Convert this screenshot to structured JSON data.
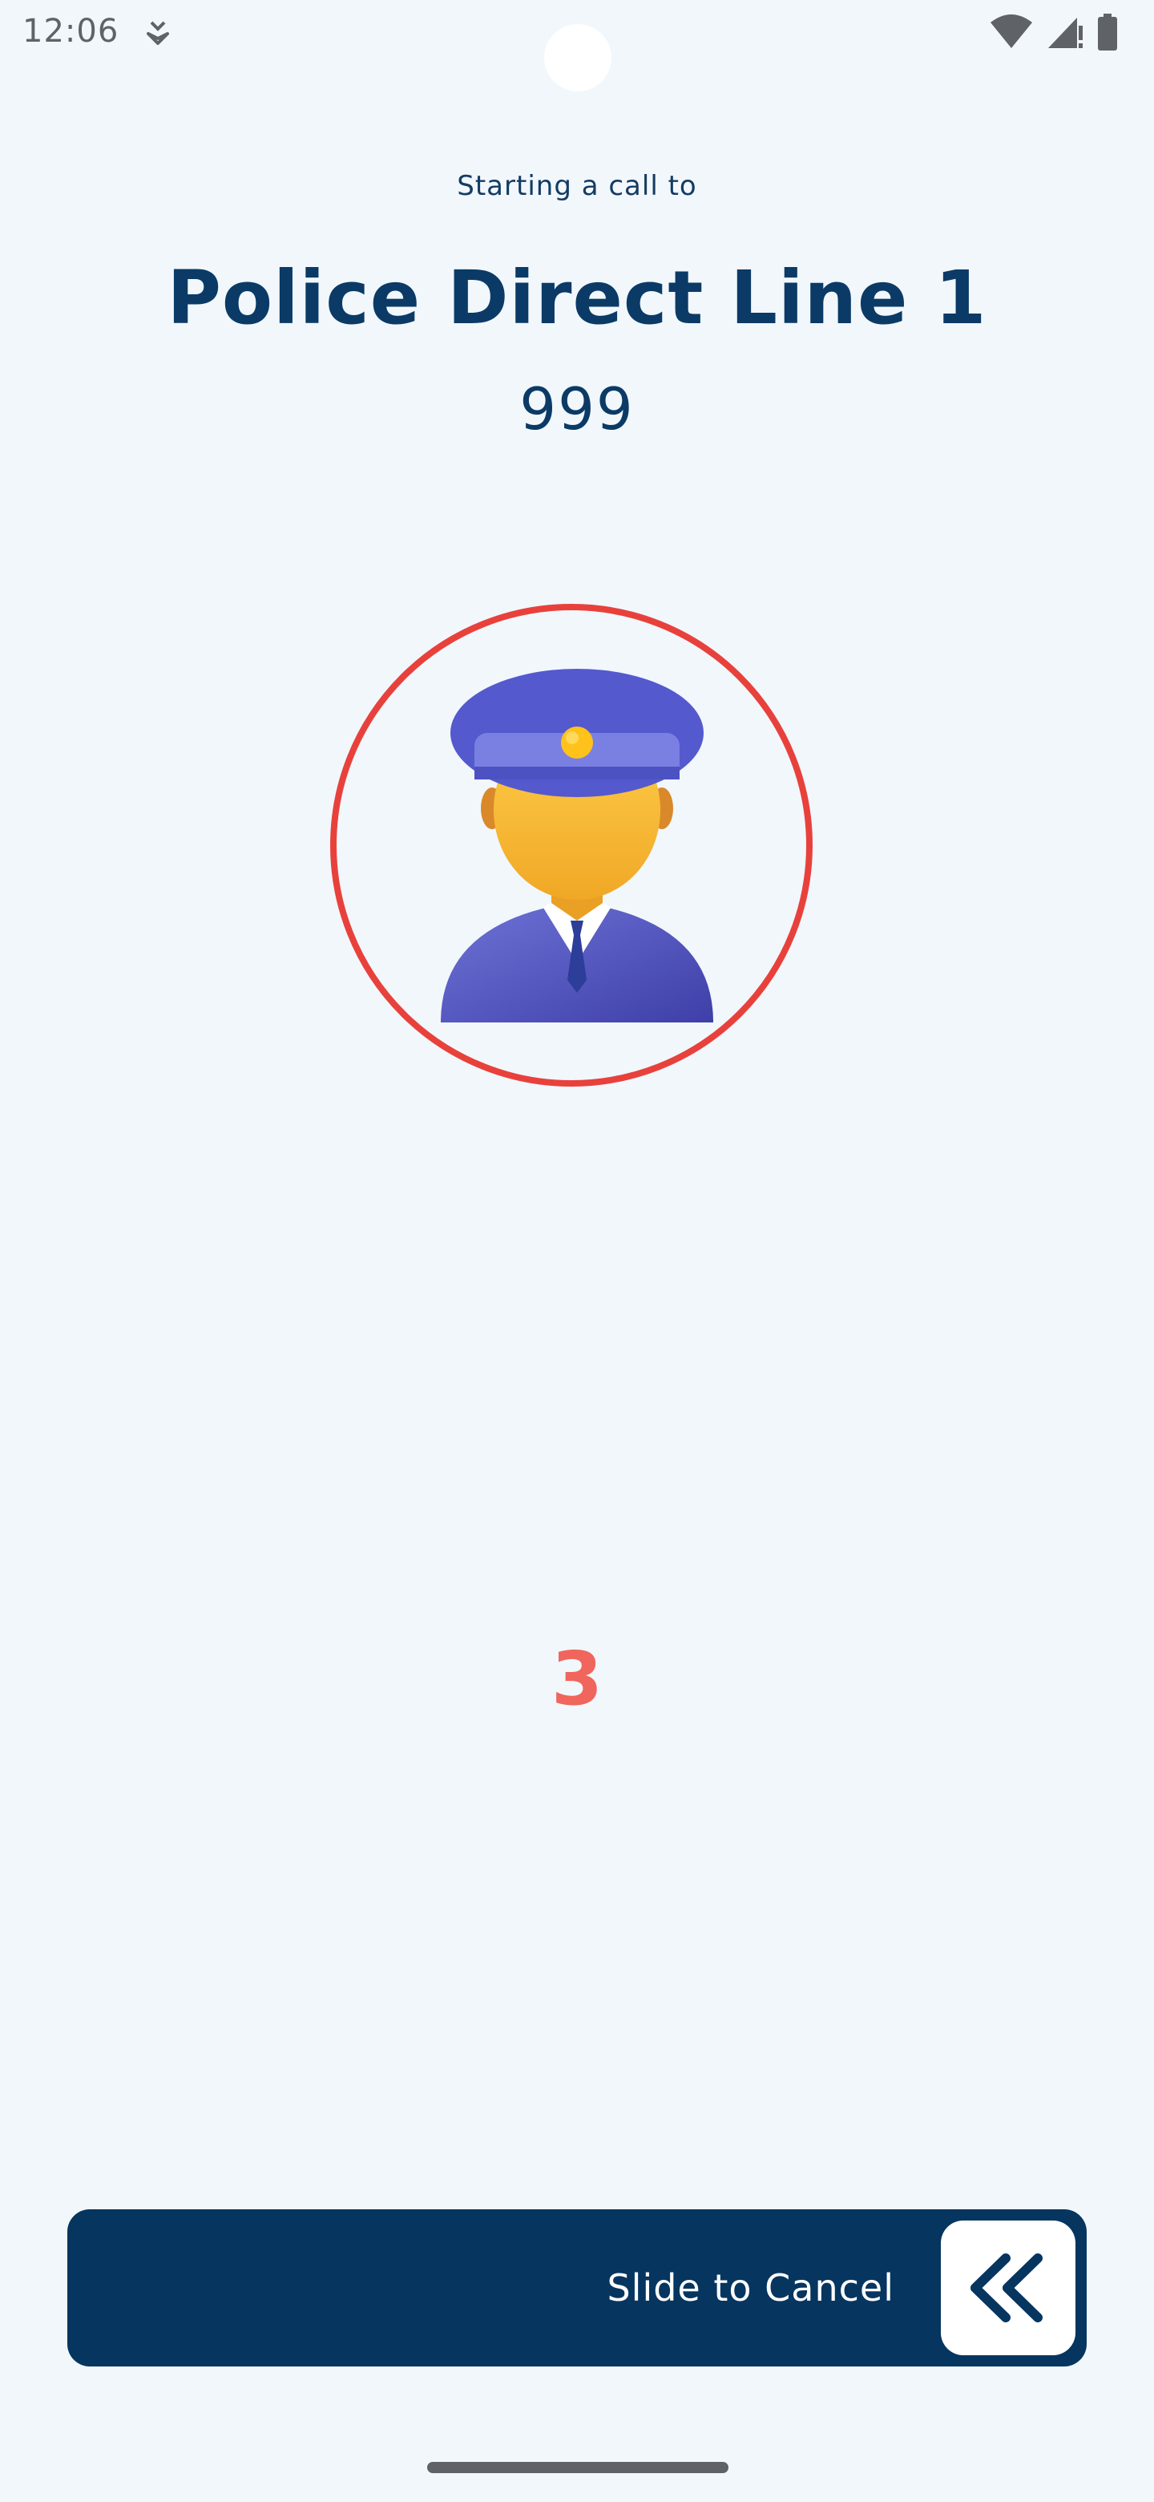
{
  "status_bar": {
    "time": "12:06",
    "icons": {
      "left": "download-notification-icon",
      "wifi": "wifi-icon",
      "cellular": "cellular-signal-icon",
      "battery": "battery-icon"
    }
  },
  "call": {
    "subtitle": "Starting a call to",
    "contact_name": "Police Direct Line 1",
    "number": "999",
    "avatar": "police-officer-icon",
    "countdown": "3"
  },
  "slider": {
    "label": "Slide to Cancel",
    "handle_icon": "double-chevron-left-icon"
  },
  "colors": {
    "background": "#F1F7FB",
    "primary": "#0B3A66",
    "ring": "#E8413C",
    "countdown": "#F0655C",
    "slider": "#06355F"
  }
}
